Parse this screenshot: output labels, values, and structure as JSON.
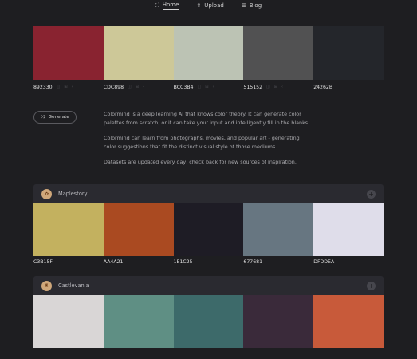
{
  "nav": [
    {
      "icon": "⛶",
      "label": "Home",
      "active": true
    },
    {
      "icon": "⇧",
      "label": "Upload",
      "active": false
    },
    {
      "icon": "≣",
      "label": "Blog",
      "active": false
    }
  ],
  "hero_palette": [
    {
      "hex": "892330",
      "color": "#892330"
    },
    {
      "hex": "CDC898",
      "color": "#CDC898"
    },
    {
      "hex": "BCC3B4",
      "color": "#BCC3B4"
    },
    {
      "hex": "515152",
      "color": "#515152"
    },
    {
      "hex": "24262B",
      "color": "#24262B"
    }
  ],
  "generate_button": {
    "icon": "⤨",
    "label": "Generate"
  },
  "intro": [
    "Colormind is a deep learning AI that knows color theory. It can generate color palettes from scratch, or it can take your input and intelligently fill in the blanks",
    "Colormind can learn from photographs, movies, and popular art - generating color suggestions that fit the distinct visual style of those mediums.",
    "Datasets are updated every day, check back for new sources of inspiration."
  ],
  "cards": [
    {
      "title": "Maplestory",
      "avatar": "✿",
      "colors": [
        {
          "hex": "C3B15F",
          "color": "#C3B15F"
        },
        {
          "hex": "AA4A21",
          "color": "#AA4A21"
        },
        {
          "hex": "1E1C25",
          "color": "#1E1C25"
        },
        {
          "hex": "677681",
          "color": "#677681"
        },
        {
          "hex": "DFDDEA",
          "color": "#DFDDEA"
        }
      ]
    },
    {
      "title": "Castlevania",
      "avatar": "♜",
      "colors": [
        {
          "hex": "",
          "color": "#d9d6d6"
        },
        {
          "hex": "",
          "color": "#5f8f84"
        },
        {
          "hex": "",
          "color": "#3d6a6a"
        },
        {
          "hex": "",
          "color": "#3a2a3a"
        },
        {
          "hex": "",
          "color": "#c85a3a"
        }
      ]
    }
  ]
}
